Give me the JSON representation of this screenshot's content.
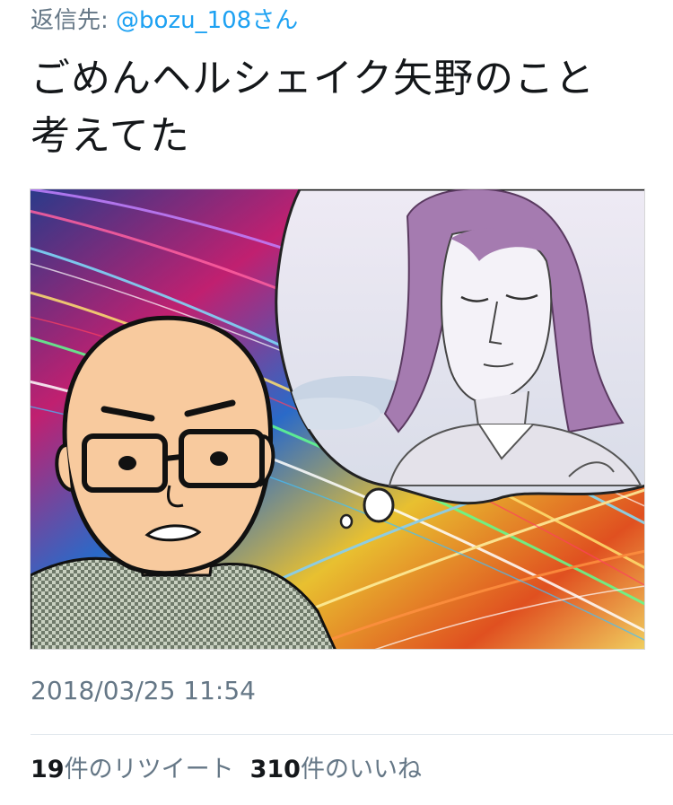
{
  "tweet": {
    "reply_prefix": "返信先: ",
    "reply_handle": "@bozu_108",
    "reply_suffix": "さん",
    "text_line1": "ごめんヘルシェイク矢野のこと",
    "text_line2": "考えてた",
    "timestamp": "2018/03/25 11:54",
    "retweet_count": "19",
    "retweet_label": "件のリツイート",
    "like_count": "310",
    "like_label": "件のいいね"
  },
  "colors": {
    "text": "#14171a",
    "secondary": "#657786",
    "link": "#1da1f2",
    "divider": "#e1e8ed"
  },
  "media": {
    "icon": "photo-illustration"
  }
}
